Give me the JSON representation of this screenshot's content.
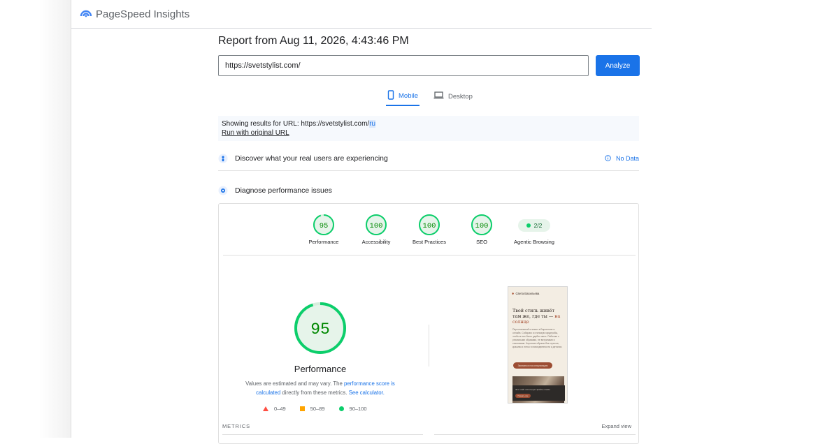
{
  "app": {
    "title": "PageSpeed Insights"
  },
  "report": {
    "title": "Report from Aug 11, 2026, 4:43:46 PM"
  },
  "search": {
    "url_value": "https://svetstylist.com/",
    "analyze_label": "Analyze"
  },
  "tabs": [
    {
      "label": "Mobile",
      "icon": "smartphone-icon",
      "selected": true
    },
    {
      "label": "Desktop",
      "icon": "laptop-icon",
      "selected": false
    }
  ],
  "notice": {
    "prefix": "Showing results for URL: ",
    "url_base": "https://svetstylist.com/",
    "url_highlight": "ru",
    "run_original_label": "Run with original URL"
  },
  "sections": {
    "discover": {
      "title": "Discover what your real users are experiencing",
      "status_label": "No Data",
      "icon": "users-icon"
    },
    "diagnose": {
      "title": "Diagnose performance issues",
      "icon": "lab-icon"
    }
  },
  "scores": [
    {
      "value": "95",
      "label": "Performance"
    },
    {
      "value": "100",
      "label": "Accessibility"
    },
    {
      "value": "100",
      "label": "Best Practices"
    },
    {
      "value": "100",
      "label": "SEO"
    }
  ],
  "agentic": {
    "value": "2/2",
    "label": "Agentic Browsing"
  },
  "performance": {
    "score": "95",
    "label": "Performance",
    "desc_before": "Values are estimated and may vary. The ",
    "desc_link1": "performance score is calculated",
    "desc_mid": " directly from these metrics. ",
    "desc_link2": "See calculator.",
    "legend": [
      {
        "range": "0–49",
        "color": "#ff4e42",
        "shape": "triangle"
      },
      {
        "range": "50–89",
        "color": "#ffa400",
        "shape": "square"
      },
      {
        "range": "90–100",
        "color": "#0cce6b",
        "shape": "circle"
      }
    ]
  },
  "screenshot": {
    "site_name": "Света Васильева",
    "headline_main": "Твой стиль живёт там же, где ты —",
    "headline_accent": "на солнце",
    "body_text": "Персональный стилист в Барселоне и онлайн. Собираю и стилизую гардеробы, чтобы в них было удобно жить. Работаю с реальными образами, не витринами и сезонными. Короткие образы без стресса, красиво и легко в повседневности и деталях.",
    "cta_label": "Записаться на консультацию",
    "cookie_text": "Этот сайт использует файлы cookie",
    "cookie_button": "Принять все"
  },
  "metrics": {
    "label": "METRICS",
    "expand_label": "Expand view"
  },
  "colors": {
    "accent": "#1a73e8",
    "good": "#0cce6b",
    "good_text": "#008800",
    "good_fill": "#e6f4ea"
  }
}
